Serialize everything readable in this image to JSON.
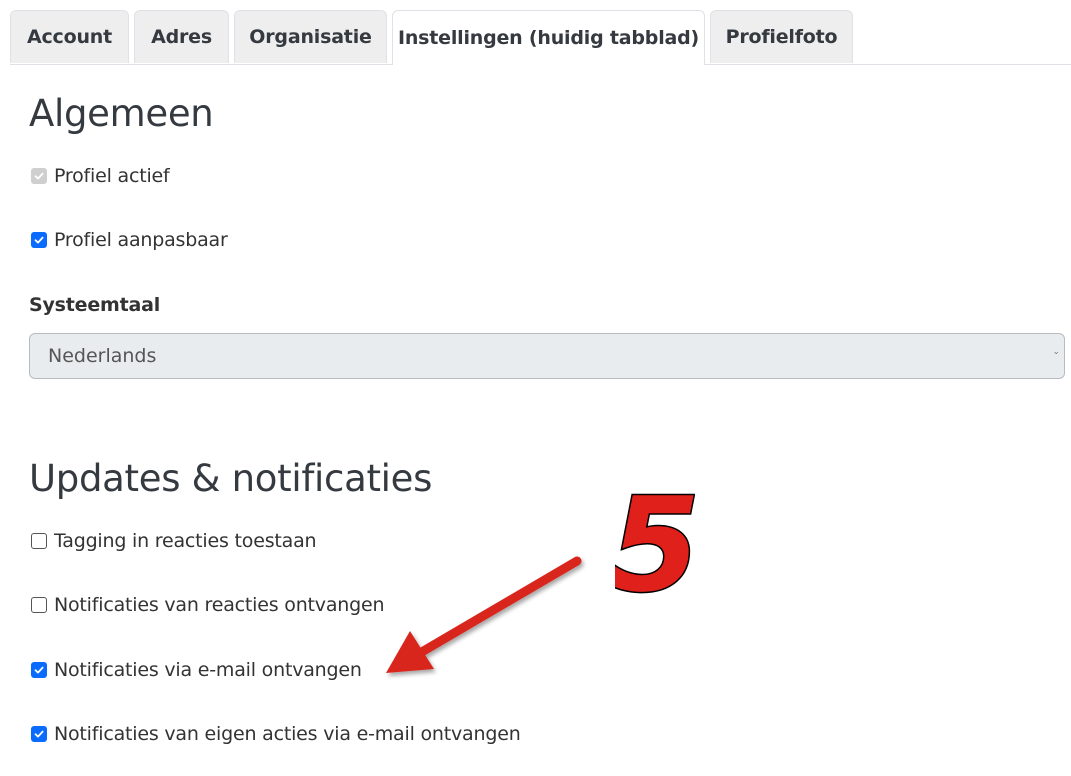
{
  "tabs": [
    {
      "label": "Account",
      "active": false
    },
    {
      "label": "Adres",
      "active": false
    },
    {
      "label": "Organisatie",
      "active": false
    },
    {
      "label": "Instellingen (huidig tabblad)",
      "active": true
    },
    {
      "label": "Profielfoto",
      "active": false
    }
  ],
  "general": {
    "title": "Algemeen",
    "profile_active": {
      "label": "Profiel actief",
      "checked": true,
      "disabled": true
    },
    "profile_editable": {
      "label": "Profiel aanpasbaar",
      "checked": true
    },
    "language_label": "Systeemtaal",
    "language_value": "Nederlands"
  },
  "updates": {
    "title": "Updates & notificaties",
    "items": [
      {
        "label": "Tagging in reacties toestaan",
        "checked": false
      },
      {
        "label": "Notificaties van reacties ontvangen",
        "checked": false
      },
      {
        "label": "Notificaties via e-mail ontvangen",
        "checked": true
      },
      {
        "label": "Notificaties van eigen acties via e-mail ontvangen",
        "checked": true
      }
    ]
  },
  "annotation": {
    "step_number": "5",
    "color": "#e0211b"
  },
  "colors": {
    "accent": "#0a6bff",
    "tab_bg": "#eeeeee"
  }
}
